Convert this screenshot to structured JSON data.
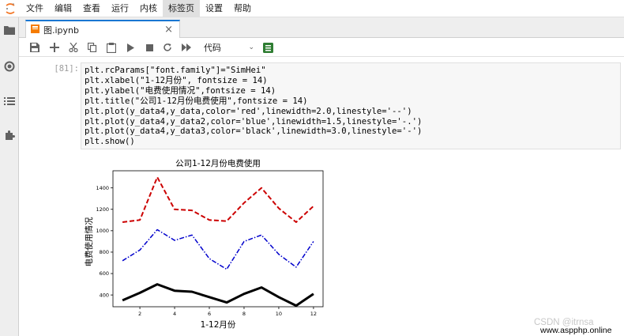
{
  "menubar": {
    "items": [
      "文件",
      "编辑",
      "查看",
      "运行",
      "内核",
      "标签页",
      "设置",
      "帮助"
    ],
    "active_index": 5
  },
  "sidebar": {
    "icons": [
      "folder-icon",
      "running-icon",
      "toc-icon",
      "extension-icon"
    ]
  },
  "tab": {
    "title": "图.ipynb",
    "close_glyph": "×"
  },
  "toolbar": {
    "cell_type": "代码",
    "dropdown_glyph": "⌄"
  },
  "cell": {
    "prompt": "[81]:",
    "code_lines": [
      "plt.rcParams[\"font.family\"]=\"SimHei\"",
      "plt.xlabel(\"1-12月份\", fontsize = 14)",
      "plt.ylabel(\"电费使用情况\",fontsize = 14)",
      "plt.title(\"公司1-12月份电费使用\",fontsize = 14)",
      "plt.plot(y_data4,y_data,color='red',linewidth=2.0,linestyle='--')",
      "plt.plot(y_data4,y_data2,color='blue',linewidth=1.5,linestyle='-.')",
      "plt.plot(y_data4,y_data3,color='black',linewidth=3.0,linestyle='-')",
      "plt.show()"
    ]
  },
  "chart_data": {
    "type": "line",
    "title": "公司1-12月份电费使用",
    "xlabel": "1-12月份",
    "ylabel": "电费使用情况",
    "x": [
      1,
      2,
      3,
      4,
      5,
      6,
      7,
      8,
      9,
      10,
      11,
      12
    ],
    "xticks": [
      2,
      4,
      6,
      8,
      10,
      12
    ],
    "yticks": [
      400,
      600,
      800,
      1000,
      1200,
      1400
    ],
    "xlim": [
      0.45,
      12.55
    ],
    "ylim": [
      290,
      1560
    ],
    "grid": false,
    "series": [
      {
        "color": "#cc0000",
        "linestyle": "--",
        "linewidth": 2.0,
        "values": [
          1080,
          1100,
          1500,
          1200,
          1190,
          1100,
          1090,
          1260,
          1400,
          1210,
          1080,
          1230
        ]
      },
      {
        "color": "#0000cc",
        "linestyle": "-.",
        "linewidth": 1.5,
        "values": [
          720,
          820,
          1010,
          910,
          960,
          740,
          640,
          900,
          960,
          780,
          660,
          900
        ]
      },
      {
        "color": "#000000",
        "linestyle": "-",
        "linewidth": 3.0,
        "values": [
          350,
          420,
          500,
          440,
          430,
          380,
          330,
          410,
          470,
          380,
          300,
          410
        ]
      }
    ]
  },
  "watermarks": {
    "csdn": "CSDN @itrnsa",
    "site": "www.aspphp.online"
  }
}
